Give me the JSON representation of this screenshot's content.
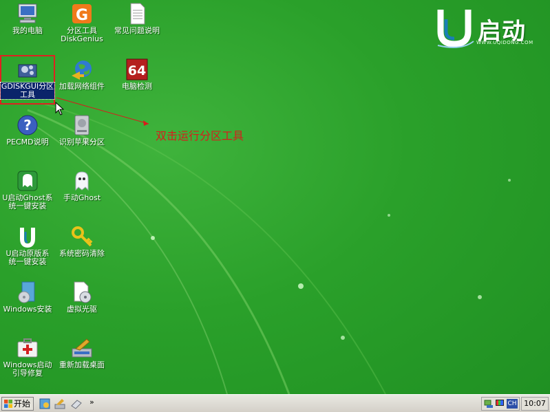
{
  "desktop": {
    "icons": [
      {
        "label": "我的电脑"
      },
      {
        "label": "分区工具\nDiskGenius"
      },
      {
        "label": "常见问题说明"
      },
      {
        "label": "GDISKGUI分区\n工具"
      },
      {
        "label": "加载网络组件"
      },
      {
        "label": "电脑检测"
      },
      {
        "label": "PECMD说明"
      },
      {
        "label": "识别苹果分区"
      },
      {
        "label": "U启动Ghost系\n统一键安装"
      },
      {
        "label": "手动Ghost"
      },
      {
        "label": "U启动原版系\n统一键安装"
      },
      {
        "label": "系统密码清除"
      },
      {
        "label": "Windows安装"
      },
      {
        "label": "虚拟光驱"
      },
      {
        "label": "Windows启动\n引导修复"
      },
      {
        "label": "重新加载桌面"
      }
    ],
    "annotation": "双击运行分区工具",
    "logo": {
      "brand": "启动",
      "url": "WWW.UQIDONG.COM"
    },
    "badge_64": "64"
  },
  "taskbar": {
    "start_label": "开始",
    "chevron": "»",
    "tray_ch": "CH",
    "clock": "10:07"
  },
  "colors": {
    "desktop": "#2aa02a",
    "annotation": "#d81c1c",
    "selection": "#0a246a"
  }
}
